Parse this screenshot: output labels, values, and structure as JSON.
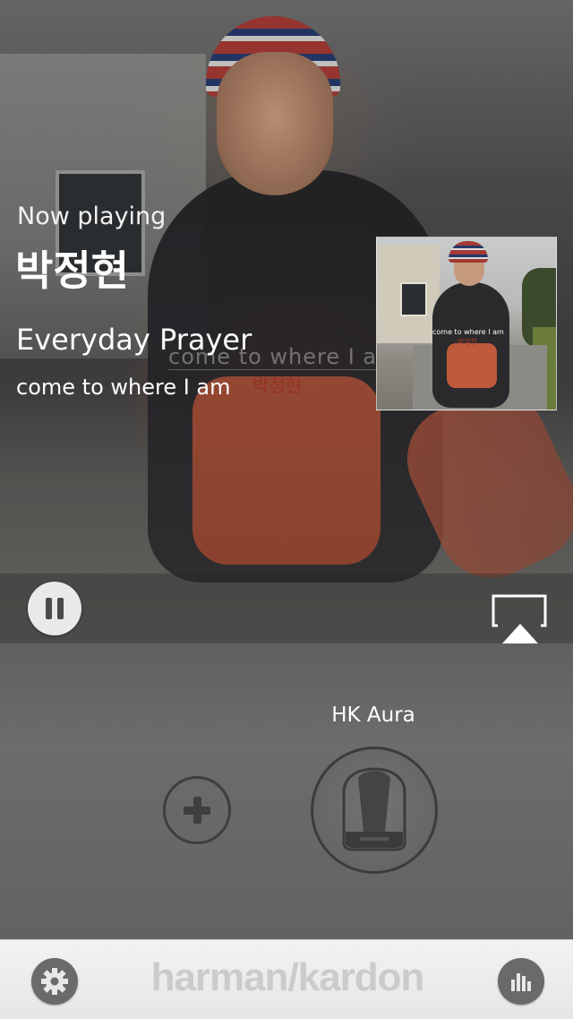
{
  "now_playing": {
    "label": "Now playing",
    "artist": "박정현",
    "track": "Everyday Prayer",
    "album": "come to where I am"
  },
  "album_art": {
    "overlay_title": "come to where I am",
    "overlay_artist": "박정현",
    "thumb_title": "come to where I am",
    "thumb_artist": "박정현"
  },
  "controls": {
    "pause_icon": "pause-icon",
    "airplay_icon": "airplay-icon"
  },
  "speaker": {
    "name": "HK Aura",
    "add_icon": "plus-icon",
    "speaker_icon": "hk-aura-speaker-icon"
  },
  "bottom_bar": {
    "settings_icon": "gear-icon",
    "brand": "harman/kardon",
    "eq_icon": "equalizer-icon"
  },
  "colors": {
    "bottom_bar": "#eeeeee",
    "speaker_area": "#666666",
    "button_dark": "#6a6a6a"
  }
}
